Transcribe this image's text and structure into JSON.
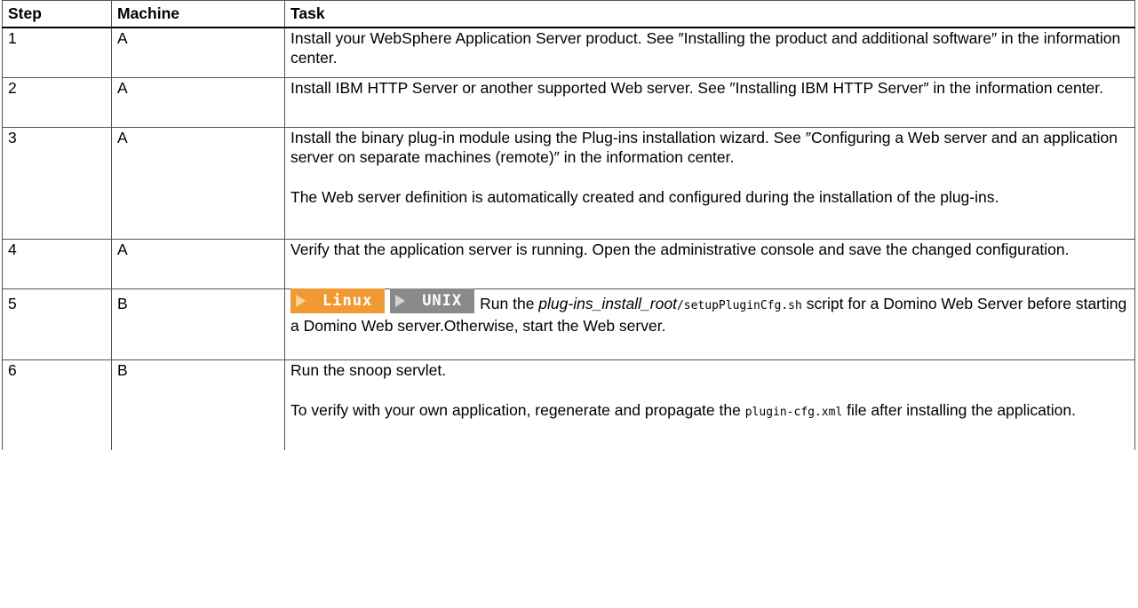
{
  "table": {
    "headers": {
      "step": "Step",
      "machine": "Machine",
      "task": "Task"
    },
    "rows": [
      {
        "step": "1",
        "machine": "A",
        "task": "Install your WebSphere Application Server product. See ″Installing the product and additional software″ in the information center."
      },
      {
        "step": "2",
        "machine": "A",
        "task": "Install IBM HTTP Server or another supported Web server. See ″Installing IBM HTTP Server″ in the information center."
      },
      {
        "step": "3",
        "machine": "A",
        "task": "Install the binary plug-in module using the Plug-ins installation wizard. See ″Configuring a Web server and an application server on separate machines (remote)″ in the information center.",
        "task_note": "The Web server definition is automatically created and configured during the installation of the plug-ins."
      },
      {
        "step": "4",
        "machine": "A",
        "task": "Verify that the application server is running. Open the administrative console and save the changed configuration."
      },
      {
        "step": "5",
        "machine": "B",
        "badges": [
          "Linux",
          "UNIX"
        ],
        "task_prefix": "Run the ",
        "task_italic": "plug-ins_install_root",
        "task_code": "/setupPluginCfg.sh",
        "task_suffix": " script for a Domino Web Server before starting a Domino Web server.Otherwise, start the Web server."
      },
      {
        "step": "6",
        "machine": "B",
        "task": "Run the snoop servlet.",
        "task_note_prefix": "To verify with your own application, regenerate and propagate the ",
        "task_note_code": "plugin-cfg.xml",
        "task_note_suffix": " file after installing the application."
      }
    ]
  },
  "colors": {
    "linux_badge": "#f19a33",
    "unix_badge": "#8a8a8a",
    "border": "#555555"
  }
}
